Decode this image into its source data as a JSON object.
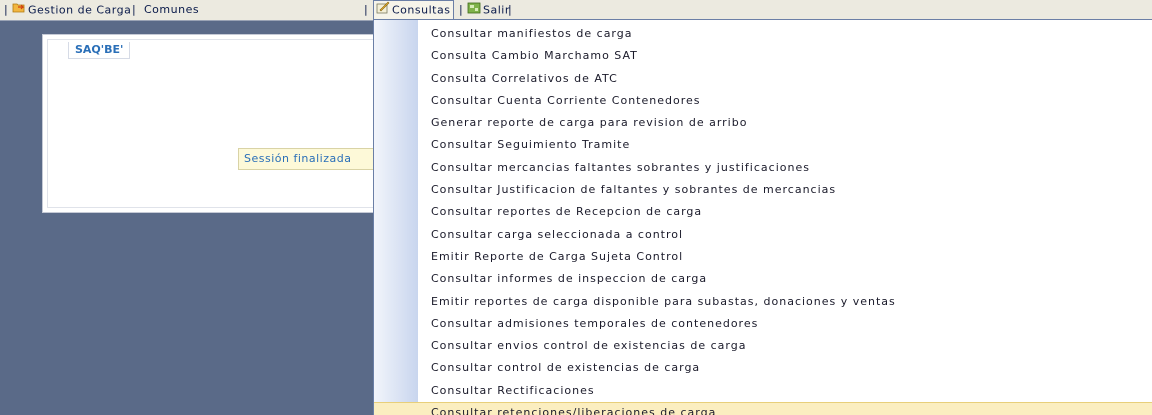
{
  "menubar": {
    "items": [
      {
        "label": "Gestion de Carga"
      },
      {
        "label": "Comunes"
      },
      {
        "label": "Consultas"
      },
      {
        "label": "Salir"
      }
    ],
    "separator": "|"
  },
  "panel": {
    "logo": "SAQ'BE'",
    "session_message": "Sessión finalizada"
  },
  "dropdown": {
    "items": [
      {
        "label": "Consultar manifiestos de carga"
      },
      {
        "label": "Consulta Cambio Marchamo SAT"
      },
      {
        "label": "Consulta Correlativos de ATC"
      },
      {
        "label": "Consultar Cuenta Corriente Contenedores"
      },
      {
        "label": "Generar reporte de carga para revision de arribo"
      },
      {
        "label": "Consultar Seguimiento Tramite"
      },
      {
        "label": "Consultar mercancias faltantes sobrantes y justificaciones"
      },
      {
        "label": "Consultar Justificacion de faltantes y sobrantes de mercancias"
      },
      {
        "label": "Consultar reportes de Recepcion de carga"
      },
      {
        "label": "Consultar carga seleccionada a control"
      },
      {
        "label": "Emitir Reporte de Carga Sujeta Control"
      },
      {
        "label": "Consultar informes de inspeccion de carga"
      },
      {
        "label": "Emitir reportes de carga disponible para subastas, donaciones y ventas"
      },
      {
        "label": "Consultar admisiones temporales de contenedores"
      },
      {
        "label": "Consultar envios control de existencias de carga"
      },
      {
        "label": "Consultar control de existencias de carga"
      },
      {
        "label": "Consultar Rectificaciones"
      },
      {
        "label": "Consultar retenciones/liberaciones de carga"
      }
    ],
    "highlighted_index": 17
  },
  "colors": {
    "desktop": "#5a6a88",
    "highlight": "#fbeec0",
    "text_blue": "#2a6fb8"
  }
}
